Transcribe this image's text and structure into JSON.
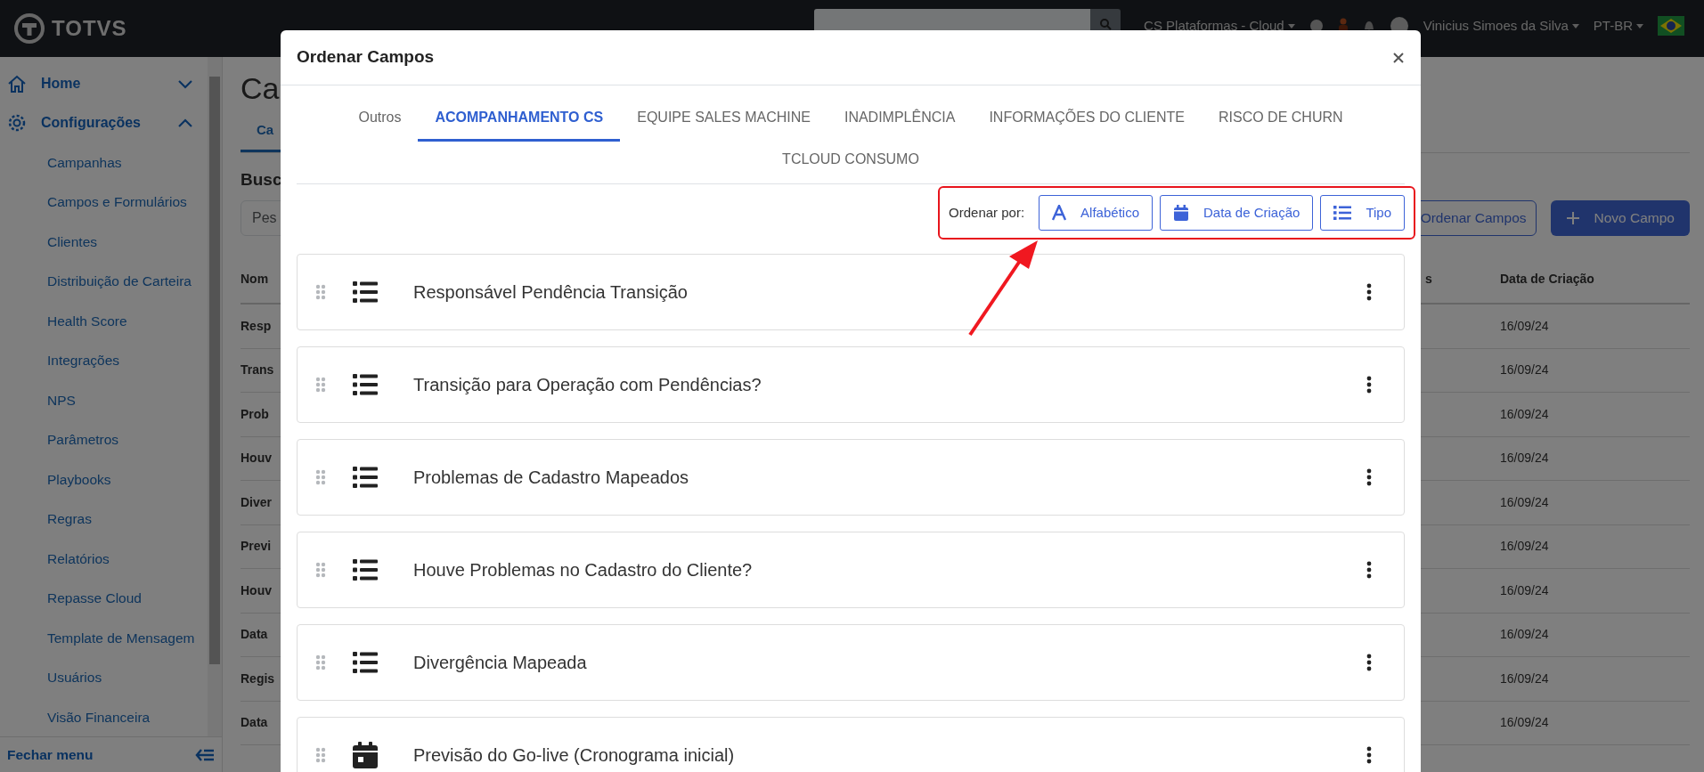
{
  "top_bar": {
    "logo": "TOTVS",
    "workspace": "CS Plataformas - Cloud",
    "user": "Vinicius Simoes da Silva",
    "language": "PT-BR"
  },
  "sidebar": {
    "items": [
      {
        "label": "Home",
        "expanded": false
      },
      {
        "label": "Configurações",
        "expanded": true,
        "children": [
          {
            "label": "Campanhas"
          },
          {
            "label": "Campos e Formulários"
          },
          {
            "label": "Clientes"
          },
          {
            "label": "Distribuição de Carteira"
          },
          {
            "label": "Health Score"
          },
          {
            "label": "Integrações"
          },
          {
            "label": "NPS"
          },
          {
            "label": "Parâmetros"
          },
          {
            "label": "Playbooks"
          },
          {
            "label": "Regras"
          },
          {
            "label": "Relatórios"
          },
          {
            "label": "Repasse Cloud"
          },
          {
            "label": "Template de Mensagem"
          },
          {
            "label": "Usuários"
          },
          {
            "label": "Visão Financeira"
          }
        ]
      }
    ],
    "footer": "Fechar menu"
  },
  "page": {
    "title": "Ca",
    "tab": "Ca",
    "section": "Busc",
    "search_placeholder": "Pes",
    "actions": [
      {
        "label": "Ordenar Campos",
        "kind": "outline"
      },
      {
        "label": "Novo Campo",
        "kind": "primary"
      }
    ],
    "table": {
      "columns": [
        "Nom",
        "s",
        "Data de Criação"
      ],
      "rows": [
        {
          "cells": [
            "Resp",
            "16/09/24"
          ]
        },
        {
          "cells": [
            "Trans",
            "16/09/24"
          ]
        },
        {
          "cells": [
            "Prob",
            "16/09/24"
          ]
        },
        {
          "cells": [
            "Houv",
            "16/09/24"
          ]
        },
        {
          "cells": [
            "Diver",
            "16/09/24"
          ]
        },
        {
          "cells": [
            "Previ",
            "16/09/24"
          ]
        },
        {
          "cells": [
            "Houv",
            "16/09/24"
          ]
        },
        {
          "cells": [
            "Data",
            "16/09/24"
          ]
        },
        {
          "cells": [
            "Regis",
            "16/09/24"
          ]
        },
        {
          "cells": [
            "Data",
            "16/09/24"
          ]
        }
      ]
    }
  },
  "modal": {
    "title": "Ordenar Campos",
    "tabs": [
      {
        "label": "Outros",
        "selected": false
      },
      {
        "label": "ACOMPANHAMENTO CS",
        "selected": true
      },
      {
        "label": "EQUIPE SALES MACHINE",
        "selected": false
      },
      {
        "label": "INADIMPLÊNCIA",
        "selected": false
      },
      {
        "label": "INFORMAÇÕES DO CLIENTE",
        "selected": false
      },
      {
        "label": "RISCO DE CHURN",
        "selected": false
      },
      {
        "label": "TCLOUD CONSUMO",
        "selected": false
      }
    ],
    "sort_label": "Ordenar por:",
    "sort_options": [
      {
        "label": "Alfabético",
        "kind": "alpha"
      },
      {
        "label": "Data de Criação",
        "kind": "date"
      },
      {
        "label": "Tipo",
        "kind": "list"
      }
    ],
    "fields": [
      {
        "label": "Responsável Pendência Transição",
        "kind": "list"
      },
      {
        "label": "Transição para Operação com Pendências?",
        "kind": "list"
      },
      {
        "label": "Problemas de Cadastro Mapeados",
        "kind": "list"
      },
      {
        "label": "Houve Problemas no Cadastro do Cliente?",
        "kind": "list"
      },
      {
        "label": "Divergência Mapeada",
        "kind": "list"
      },
      {
        "label": "Previsão do Go-live (Cronograma inicial)",
        "kind": "date"
      }
    ]
  }
}
